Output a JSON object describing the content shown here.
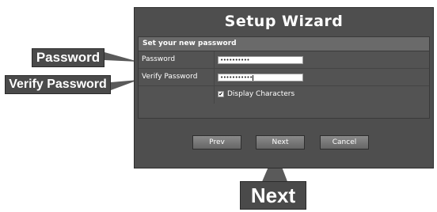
{
  "wizard": {
    "title": "Setup Wizard",
    "section_header": "Set your new password",
    "fields": {
      "password_label": "Password",
      "password_value": "••••••••••",
      "verify_label": "Verify Password",
      "verify_value": "•••••••••••",
      "display_characters_label": "Display Characters",
      "display_characters_checked": true
    },
    "buttons": {
      "prev": "Prev",
      "next": "Next",
      "cancel": "Cancel"
    }
  },
  "annotations": {
    "password": "Password",
    "verify_password": "Verify Password",
    "next": "Next"
  },
  "colors": {
    "window_bg": "#4e4e4e",
    "callout_bg": "#4a4a4a",
    "text": "#ffffff"
  },
  "icons": {
    "checkbox": "checkmark-icon"
  }
}
